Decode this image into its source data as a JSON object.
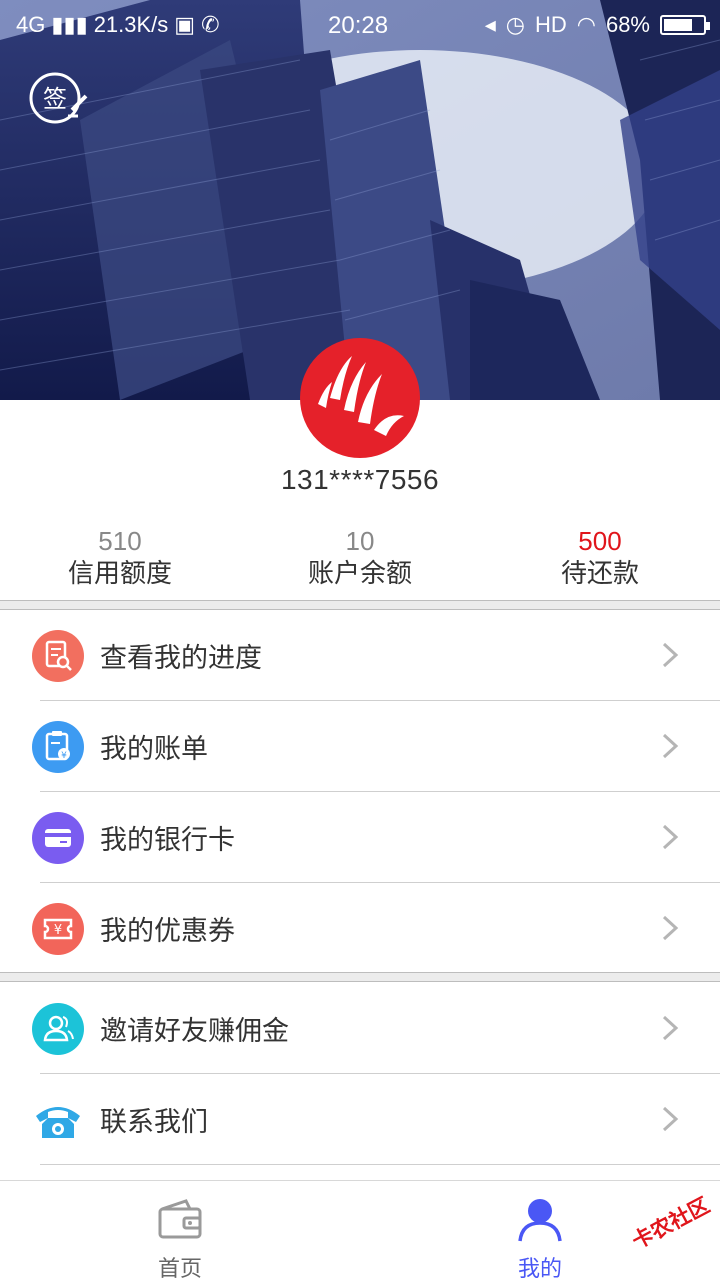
{
  "status_bar": {
    "network": "4G",
    "speed": "21.3K/s",
    "time": "20:28",
    "hd": "HD",
    "battery": "68%"
  },
  "header": {
    "sign_label": "签"
  },
  "profile": {
    "phone": "131****7556"
  },
  "stats": [
    {
      "value": "510",
      "label": "信用额度"
    },
    {
      "value": "10",
      "label": "账户余额"
    },
    {
      "value": "500",
      "label": "待还款"
    }
  ],
  "menu_group1": [
    {
      "label": "查看我的进度",
      "icon": "progress-doc-icon",
      "color": "#f26f5f"
    },
    {
      "label": "我的账单",
      "icon": "bill-icon",
      "color": "#3d9bf2"
    },
    {
      "label": "我的银行卡",
      "icon": "bank-card-icon",
      "color": "#7a5cf0"
    },
    {
      "label": "我的优惠券",
      "icon": "coupon-icon",
      "color": "#f2655a"
    }
  ],
  "menu_group2": [
    {
      "label": "邀请好友赚佣金",
      "icon": "invite-friends-icon",
      "color": "#1cc3d8"
    },
    {
      "label": "联系我们",
      "icon": "telephone-icon",
      "color": "#2fa8e6"
    }
  ],
  "tabbar": {
    "home_label": "首页",
    "mine_label": "我的",
    "active_color": "#4a57f5"
  },
  "watermark": "卡农社区"
}
